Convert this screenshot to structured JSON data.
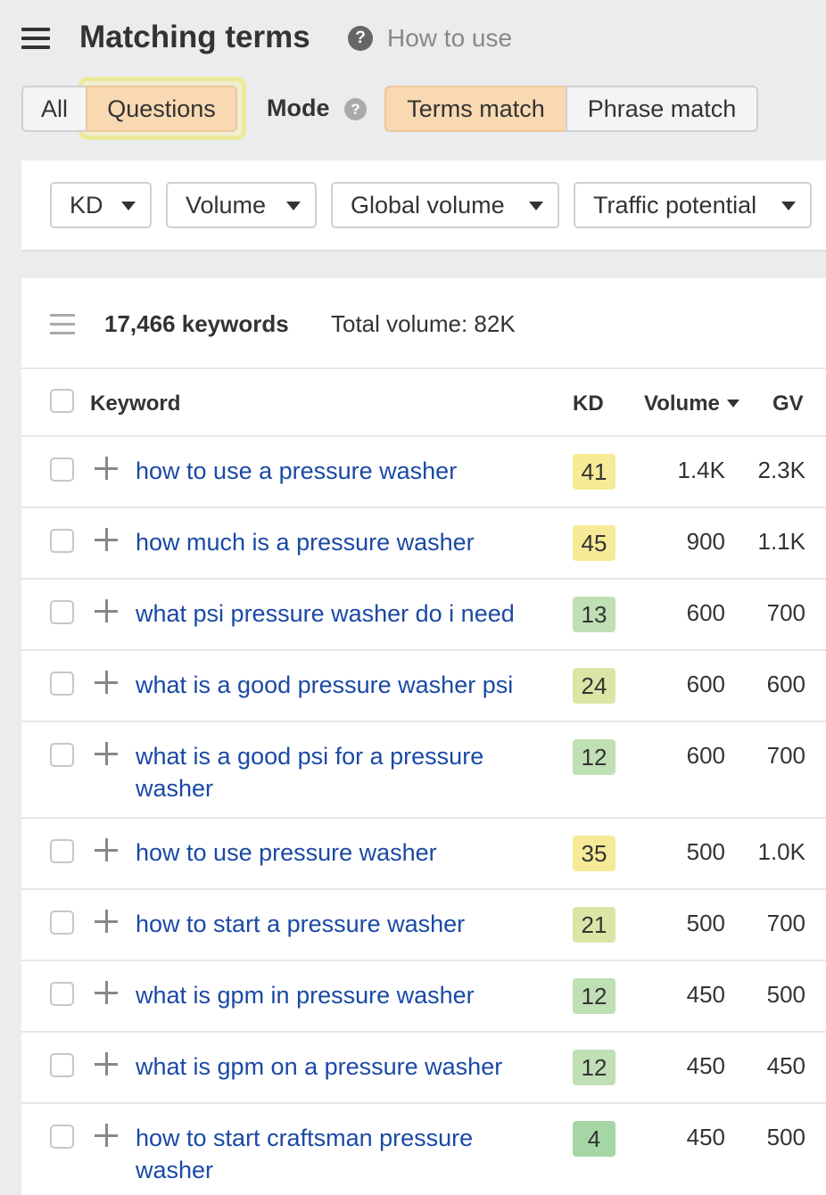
{
  "header": {
    "title": "Matching terms",
    "help_label": "How to use"
  },
  "tabs": [
    {
      "label": "All",
      "active": false
    },
    {
      "label": "Questions",
      "active": true
    }
  ],
  "mode": {
    "label": "Mode",
    "options": [
      {
        "label": "Terms match",
        "active": true
      },
      {
        "label": "Phrase match",
        "active": false
      }
    ]
  },
  "filters": [
    "KD",
    "Volume",
    "Global volume",
    "Traffic potential"
  ],
  "summary": {
    "keywords": "17,466 keywords",
    "total_volume": "Total volume: 82K"
  },
  "table": {
    "columns": {
      "keyword": "Keyword",
      "kd": "KD",
      "volume": "Volume",
      "gv": "GV"
    },
    "rows": [
      {
        "keyword": "how to use a pressure washer",
        "kd": "41",
        "volume": "1.4K",
        "gv": "2.3K"
      },
      {
        "keyword": "how much is a pressure washer",
        "kd": "45",
        "volume": "900",
        "gv": "1.1K"
      },
      {
        "keyword": "what psi pressure washer do i need",
        "kd": "13",
        "volume": "600",
        "gv": "700"
      },
      {
        "keyword": "what is a good pressure washer psi",
        "kd": "24",
        "volume": "600",
        "gv": "600"
      },
      {
        "keyword": "what is a good psi for a pressure washer",
        "kd": "12",
        "volume": "600",
        "gv": "700"
      },
      {
        "keyword": "how to use pressure washer",
        "kd": "35",
        "volume": "500",
        "gv": "1.0K"
      },
      {
        "keyword": "how to start a pressure washer",
        "kd": "21",
        "volume": "500",
        "gv": "700"
      },
      {
        "keyword": "what is gpm in pressure washer",
        "kd": "12",
        "volume": "450",
        "gv": "500"
      },
      {
        "keyword": "what is gpm on a pressure washer",
        "kd": "12",
        "volume": "450",
        "gv": "450"
      },
      {
        "keyword": "how to start craftsman pressure washer",
        "kd": "4",
        "volume": "450",
        "gv": "500"
      }
    ]
  },
  "colors": {
    "link": "#1a49a5",
    "active_tab": "#f9d9b2",
    "highlight": "#ecea9a",
    "kd_yellow": "#f6ea96",
    "kd_lime": "#dbe6a6",
    "kd_green": "#bfdfb4",
    "kd_darkgreen": "#a5d6a6"
  },
  "icons": [
    "hamburger-icon",
    "help-icon",
    "caret-down-icon",
    "list-icon",
    "plus-icon"
  ]
}
